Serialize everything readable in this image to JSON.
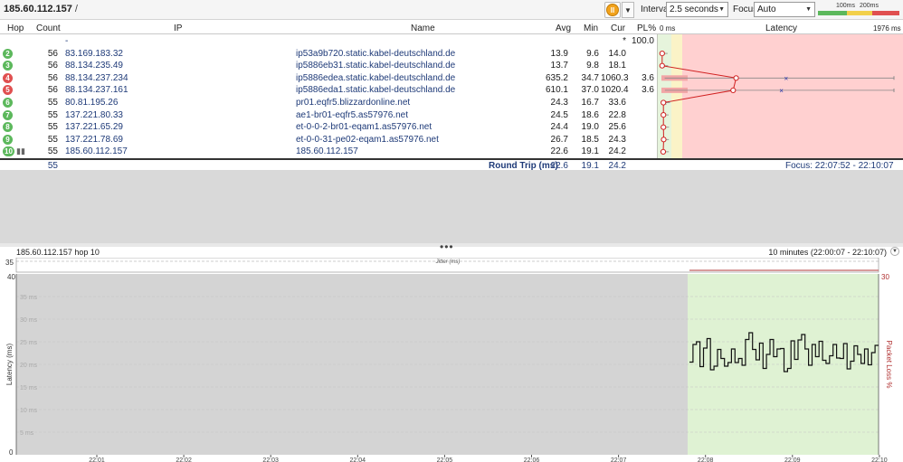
{
  "toolbar": {
    "target": "185.60.112.157",
    "slash": "/",
    "interval_label": "Interval",
    "interval_value": "2.5 seconds",
    "focus_label": "Focus",
    "focus_value": "Auto",
    "scale_100": "100ms",
    "scale_200": "200ms"
  },
  "columns": {
    "hop": "Hop",
    "count": "Count",
    "ip": "IP",
    "name": "Name",
    "avg": "Avg",
    "min": "Min",
    "cur": "Cur",
    "pl": "PL%",
    "zero_ms": "0 ms",
    "latency": "Latency",
    "max_ms": "1976 ms"
  },
  "hops": [
    {
      "hop": "",
      "count": "",
      "ip": "-",
      "name": "",
      "avg": "",
      "min": "",
      "cur": "*",
      "pl": "100.0",
      "status": "none"
    },
    {
      "hop": "2",
      "count": "56",
      "ip": "83.169.183.32",
      "name": "ip53a9b720.static.kabel-deutschland.de",
      "avg": "13.9",
      "min": "9.6",
      "cur": "14.0",
      "pl": "",
      "status": "green"
    },
    {
      "hop": "3",
      "count": "56",
      "ip": "88.134.235.49",
      "name": "ip5886eb31.static.kabel-deutschland.de",
      "avg": "13.7",
      "min": "9.8",
      "cur": "18.1",
      "pl": "",
      "status": "green"
    },
    {
      "hop": "4",
      "count": "56",
      "ip": "88.134.237.234",
      "name": "ip5886edea.static.kabel-deutschland.de",
      "avg": "635.2",
      "min": "34.7",
      "cur": "1060.3",
      "pl": "3.6",
      "status": "red"
    },
    {
      "hop": "5",
      "count": "56",
      "ip": "88.134.237.161",
      "name": "ip5886eda1.static.kabel-deutschland.de",
      "avg": "610.1",
      "min": "37.0",
      "cur": "1020.4",
      "pl": "3.6",
      "status": "red"
    },
    {
      "hop": "6",
      "count": "55",
      "ip": "80.81.195.26",
      "name": "pr01.eqfr5.blizzardonline.net",
      "avg": "24.3",
      "min": "16.7",
      "cur": "33.6",
      "pl": "",
      "status": "green"
    },
    {
      "hop": "7",
      "count": "55",
      "ip": "137.221.80.33",
      "name": "ae1-br01-eqfr5.as57976.net",
      "avg": "24.5",
      "min": "18.6",
      "cur": "22.8",
      "pl": "",
      "status": "green"
    },
    {
      "hop": "8",
      "count": "55",
      "ip": "137.221.65.29",
      "name": "et-0-0-2-br01-eqam1.as57976.net",
      "avg": "24.4",
      "min": "19.0",
      "cur": "25.6",
      "pl": "",
      "status": "green"
    },
    {
      "hop": "9",
      "count": "55",
      "ip": "137.221.78.69",
      "name": "et-0-0-31-pe02-eqam1.as57976.net",
      "avg": "26.7",
      "min": "18.5",
      "cur": "24.3",
      "pl": "",
      "status": "green"
    },
    {
      "hop": "10",
      "count": "55",
      "ip": "185.60.112.157",
      "name": "185.60.112.157",
      "avg": "22.6",
      "min": "19.1",
      "cur": "24.2",
      "pl": "",
      "status": "green"
    }
  ],
  "summary": {
    "count": "55",
    "label": "Round Trip (ms)",
    "avg": "22.6",
    "min": "19.1",
    "cur": "24.2",
    "focus": "Focus: 22:07:52 - 22:10:07"
  },
  "graph": {
    "title": "185.60.112.157 hop 10",
    "range": "10 minutes (22:00:07 - 22:10:07)",
    "jitter_label": "Jitter (ms)",
    "jitter_max": "35",
    "y_left_top": "40",
    "y_left_bottom": "0",
    "y_right_top": "30",
    "y_left_label": "Latency (ms)",
    "y_right_label": "Packet Loss %",
    "gridlines": [
      "35 ms",
      "30 ms",
      "25 ms",
      "20 ms",
      "15 ms",
      "10 ms",
      "5 ms"
    ],
    "x_ticks": [
      "22:01",
      "22:02",
      "22:03",
      "22:04",
      "22:05",
      "22:06",
      "22:07",
      "22:08",
      "22:09",
      "22:10"
    ]
  },
  "colors": {
    "green": "#5cb85c",
    "red": "#e05050",
    "latency_red_zone": "#ffd0d0",
    "graph_green": "#dff2d3",
    "graph_gray": "#d4d4d4"
  },
  "chart_data": {
    "type": "line",
    "title": "185.60.112.157 hop 10",
    "xlabel": "",
    "ylabel": "Latency (ms)",
    "ylim": [
      0,
      40
    ],
    "series": [
      {
        "name": "",
        "values": [
          20.5,
          24.4,
          25.0,
          19.5,
          23.6,
          25.7,
          18.8,
          19.6,
          23.3,
          21.3,
          19.6,
          20.4,
          23.4,
          20.4,
          21.3,
          19.8,
          25.5,
          27.0,
          23.3,
          21.0,
          24.7,
          19.1,
          22.2,
          25.5,
          21.7,
          23.4,
          23.5,
          18.4,
          19.1,
          25.2,
          21.1,
          25.4,
          26.6,
          23.4,
          19.8,
          24.4,
          21.7,
          25.1,
          20.9,
          20.2,
          21.9,
          24.4,
          21.4,
          21.3,
          24.6,
          19.0,
          20.7,
          24.1,
          22.2,
          20.2,
          23.4,
          19.9,
          22.6,
          24.2
        ]
      }
    ],
    "x_range": [
      "22:07:52",
      "22:10:07"
    ]
  }
}
